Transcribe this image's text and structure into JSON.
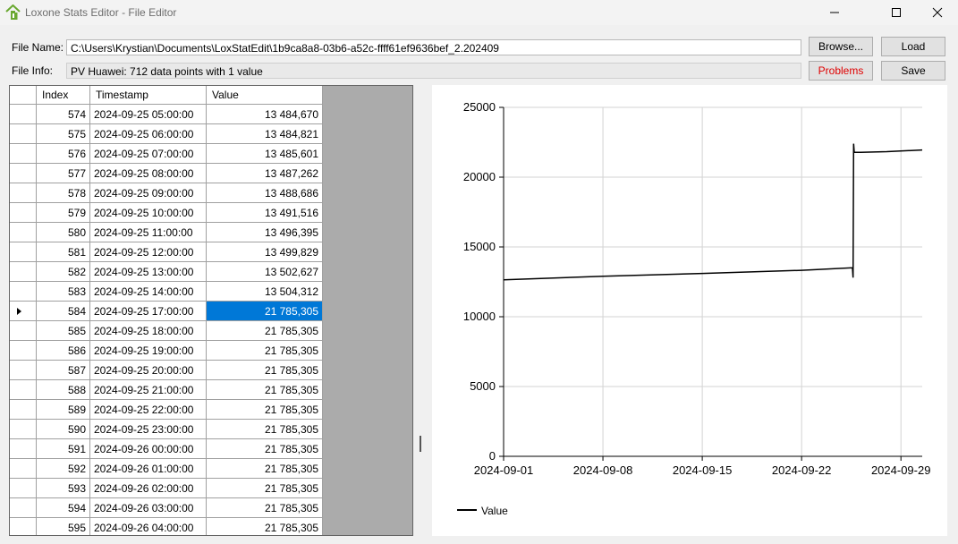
{
  "window": {
    "title": "Loxone Stats Editor - File Editor"
  },
  "form": {
    "file_name_label": "File Name:",
    "file_name_value": "C:\\Users\\Krystian\\Documents\\LoxStatEdit\\1b9ca8a8-03b6-a52c-ffff61ef9636bef_2.202409",
    "file_info_label": "File Info:",
    "file_info_value": "PV Huawei: 712 data points with 1 value",
    "browse_label": "Browse...",
    "load_label": "Load",
    "problems_label": "Problems",
    "save_label": "Save",
    "problems_color": "#e00000"
  },
  "grid": {
    "columns": [
      "",
      "Index",
      "Timestamp",
      "Value"
    ],
    "selected_index": "584",
    "selection_color": "#0078d7",
    "rows": [
      {
        "index": "574",
        "timestamp": "2024-09-25 05:00:00",
        "value": "13 484,670"
      },
      {
        "index": "575",
        "timestamp": "2024-09-25 06:00:00",
        "value": "13 484,821"
      },
      {
        "index": "576",
        "timestamp": "2024-09-25 07:00:00",
        "value": "13 485,601"
      },
      {
        "index": "577",
        "timestamp": "2024-09-25 08:00:00",
        "value": "13 487,262"
      },
      {
        "index": "578",
        "timestamp": "2024-09-25 09:00:00",
        "value": "13 488,686"
      },
      {
        "index": "579",
        "timestamp": "2024-09-25 10:00:00",
        "value": "13 491,516"
      },
      {
        "index": "580",
        "timestamp": "2024-09-25 11:00:00",
        "value": "13 496,395"
      },
      {
        "index": "581",
        "timestamp": "2024-09-25 12:00:00",
        "value": "13 499,829"
      },
      {
        "index": "582",
        "timestamp": "2024-09-25 13:00:00",
        "value": "13 502,627"
      },
      {
        "index": "583",
        "timestamp": "2024-09-25 14:00:00",
        "value": "13 504,312"
      },
      {
        "index": "584",
        "timestamp": "2024-09-25 17:00:00",
        "value": "21 785,305"
      },
      {
        "index": "585",
        "timestamp": "2024-09-25 18:00:00",
        "value": "21 785,305"
      },
      {
        "index": "586",
        "timestamp": "2024-09-25 19:00:00",
        "value": "21 785,305"
      },
      {
        "index": "587",
        "timestamp": "2024-09-25 20:00:00",
        "value": "21 785,305"
      },
      {
        "index": "588",
        "timestamp": "2024-09-25 21:00:00",
        "value": "21 785,305"
      },
      {
        "index": "589",
        "timestamp": "2024-09-25 22:00:00",
        "value": "21 785,305"
      },
      {
        "index": "590",
        "timestamp": "2024-09-25 23:00:00",
        "value": "21 785,305"
      },
      {
        "index": "591",
        "timestamp": "2024-09-26 00:00:00",
        "value": "21 785,305"
      },
      {
        "index": "592",
        "timestamp": "2024-09-26 01:00:00",
        "value": "21 785,305"
      },
      {
        "index": "593",
        "timestamp": "2024-09-26 02:00:00",
        "value": "21 785,305"
      },
      {
        "index": "594",
        "timestamp": "2024-09-26 03:00:00",
        "value": "21 785,305"
      },
      {
        "index": "595",
        "timestamp": "2024-09-26 04:00:00",
        "value": "21 785,305"
      }
    ]
  },
  "chart_data": {
    "type": "line",
    "title": "",
    "xlabel": "",
    "ylabel": "",
    "x_tick_labels": [
      "2024-09-01",
      "2024-09-08",
      "2024-09-15",
      "2024-09-22",
      "2024-09-29"
    ],
    "y_ticks": [
      0,
      5000,
      10000,
      15000,
      20000,
      25000
    ],
    "xlim": [
      "2024-09-01",
      "2024-09-30 12:00"
    ],
    "ylim": [
      0,
      25000
    ],
    "grid": true,
    "legend_position": "bottom-left",
    "line_color": "#000000",
    "series": [
      {
        "name": "Value",
        "x": [
          "2024-09-01",
          "2024-09-08",
          "2024-09-15",
          "2024-09-22",
          "2024-09-25 14:00",
          "2024-09-25 15:00",
          "2024-09-25 16:00",
          "2024-09-25 17:00",
          "2024-09-25 18:00",
          "2024-09-26 04:00",
          "2024-09-28",
          "2024-09-30 12:00"
        ],
        "y": [
          12650,
          12900,
          13100,
          13330,
          13504,
          12800,
          22400,
          21785,
          21785,
          21785,
          21830,
          21950
        ]
      }
    ]
  }
}
